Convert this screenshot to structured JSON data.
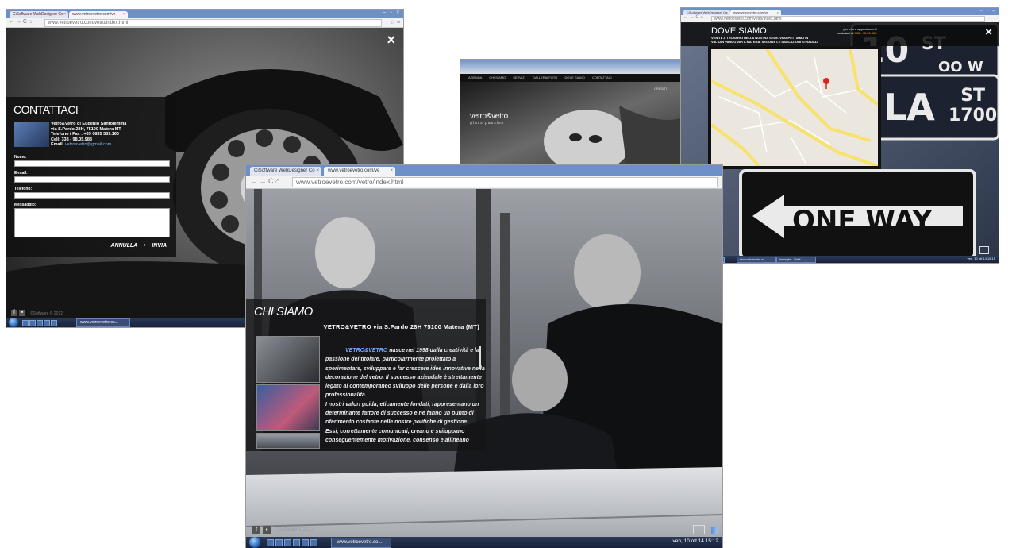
{
  "contact_window": {
    "tab1": "CiSoftware WebDesigner Co",
    "tab2": "www.vetroevetro.com/ve",
    "url": "www.vetroevetro.com/vetro/index.html",
    "close_glyph": "×",
    "panel": {
      "title": "CONTATTACI",
      "company": "Vetro&Vetro di Eugenio Santoiemma",
      "address": "via S.Pardo 28H, 75100  Matera  MT",
      "phone": "Telefono / Fax :  +39 0835 389.160",
      "cell": "Cell:   338 - 98.05.988",
      "email_label": "Email:",
      "email": "vetroevetro@gmail.com",
      "name_label": "Nome:",
      "email_field_label": "E-mail:",
      "phone_field_label": "Telefono:",
      "message_label": "Messaggio:",
      "cancel": "ANNULLA",
      "separator": "•",
      "send": "INVIA"
    },
    "copyright": "©Software © 2012",
    "taskbar_task": "www.vetroevetro.co..."
  },
  "home_window": {
    "menu": [
      "AZIENDA",
      "CHI SIAMO",
      "SERVIZI",
      "GALLERIA FOTO",
      "DOVE SIAMO",
      "CONTATTACI"
    ],
    "logo": "vetro&vetro",
    "tagline": "glass passion",
    "top_right": "CREDITI"
  },
  "map_window": {
    "tab1": "CiSoftware WebDesigner Co",
    "tab2": "www.vetroevetro.com/ve",
    "url": "www.vetroevetro.com/vetro/index.html",
    "close_glyph": "×",
    "title": "DOVE SIAMO",
    "desc_line1": "VENITE A TROVARCI NELLA NOSTRA SEDE. VI ASPETTIAMO IN",
    "desc_line2": "VIA SAN PARDO 28H A MATERA. SEGUITE LE INDICAZIONI STRADALI",
    "info_line1": "per info e appuntamenti",
    "info_line2_prefix": "contattaci al",
    "info_phone": "338 - 98.05.988",
    "sign_text_1": "10",
    "sign_text_2": "ST",
    "sign_text_3": "OO W",
    "sign_text_4": "LA",
    "sign_text_5": "ST",
    "sign_text_6": "1700",
    "oneway": "ONE WAY",
    "taskbar_task1": "www.vetroevetro.co...",
    "taskbar_task2": "Immagine - Paint",
    "clock": "ven, 10 ott 14  15:15"
  },
  "about_window": {
    "tab1": "CiSoftware WebDesigner Co",
    "tab2": "www.vetroevetro.com/ve",
    "url": "www.vetroevetro.com/vetro/index.html",
    "title": "CHI SIAMO",
    "subtitle": "VETRO&VETRO via S.Pardo 28H 75100 Matera (MT)",
    "brand_in_text": "VETRO&VETRO",
    "paragraph_lines": [
      "nasce nel 1998 dalla creatività e la",
      "passione del titolare, particolarmente proiettato a",
      "sperimentare, sviluppare e far crescere idee innovative nella",
      "decorazione del vetro. Il successo aziendale è strettamente",
      "legato al contemporaneo sviluppo delle persone e dalla loro",
      "professionalità.",
      "I nostri valori guida, eticamente fondati, rappresentano un",
      "determinante fattore di successo e ne fanno un punto di",
      "riferimento costante nelle nostre politiche di gestione.",
      "Essi, correttamente comunicati, creano e sviluppano",
      "conseguentemente motivazione, consenso e allineano"
    ],
    "copyright": "©Software © 2012",
    "taskbar_task": "www.vetroevetro.co...",
    "clock": "ven, 10 ott 14  15:12"
  }
}
